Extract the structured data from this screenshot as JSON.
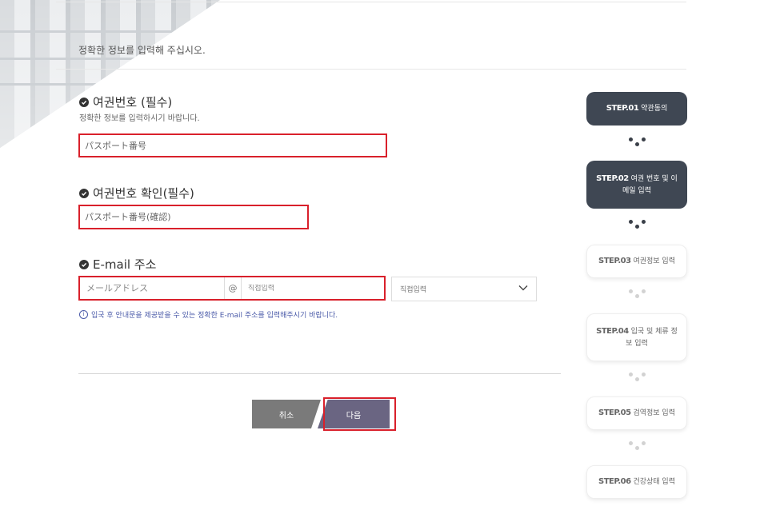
{
  "intro_text": "정확한 정보를 입력해 주십시오.",
  "passport": {
    "title": "여권번호 (필수)",
    "hint": "정확한 정보를 입력하시기 바랍니다.",
    "placeholder": "パスポート番号"
  },
  "passport_confirm": {
    "title": "여권번호 확인(필수)",
    "placeholder": "パスポート番号(確認)"
  },
  "email": {
    "title": "E-mail 주소",
    "local_placeholder": "メールアドレス",
    "at_symbol": "@",
    "domain_placeholder": "직접입력",
    "select_value": "직접입력",
    "notice": "입국 후 안내문을 제공받을 수 있는 정확한 E-mail 주소를 입력해주시기 바랍니다."
  },
  "buttons": {
    "cancel": "취소",
    "next": "다음"
  },
  "steps": [
    {
      "code": "STEP.01",
      "label": "약관동의",
      "state": "active"
    },
    {
      "code": "STEP.02",
      "label": "여권 번호 및 이메일 입력",
      "state": "active"
    },
    {
      "code": "STEP.03",
      "label": "여권정보 입력",
      "state": "inactive"
    },
    {
      "code": "STEP.04",
      "label": "입국 및 체류 정보 입력",
      "state": "inactive"
    },
    {
      "code": "STEP.05",
      "label": "검역정보 입력",
      "state": "inactive"
    },
    {
      "code": "STEP.06",
      "label": "건강상태 입력",
      "state": "inactive"
    }
  ],
  "colors": {
    "highlight_border": "#d9202b",
    "step_active": "#3f4753",
    "next_button": "#6a6582",
    "notice_text": "#4a5aa8"
  },
  "icons": [
    "check-circle-icon",
    "info-icon",
    "chevron-down-icon"
  ]
}
